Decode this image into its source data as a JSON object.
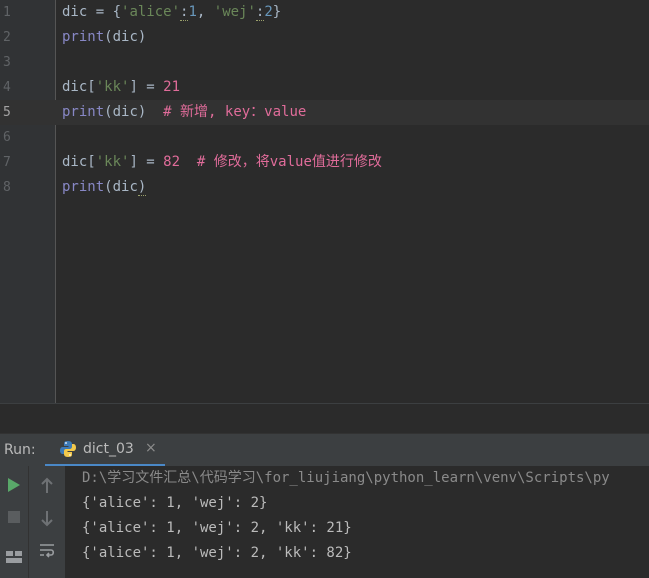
{
  "editor": {
    "lines": [
      {
        "num": "1"
      },
      {
        "num": "2"
      },
      {
        "num": "3"
      },
      {
        "num": "4"
      },
      {
        "num": "5"
      },
      {
        "num": "6"
      },
      {
        "num": "7"
      },
      {
        "num": "8"
      }
    ],
    "code": {
      "l1_a": "dic = {",
      "l1_s1": "'alice'",
      "l1_b": ":",
      "l1_n1": "1",
      "l1_c": ", ",
      "l1_s2": "'wej'",
      "l1_d": ":",
      "l1_n2": "2",
      "l1_e": "}",
      "l2_fn": "print",
      "l2_rest": "(dic)",
      "l4_a": "dic[",
      "l4_s": "'kk'",
      "l4_b": "] = ",
      "l4_n": "21",
      "l5_fn": "print",
      "l5_rest": "(dic)",
      "l5_cmt": "  # 新增, key：value",
      "l7_a": "dic[",
      "l7_s": "'kk'",
      "l7_b": "] = ",
      "l7_n": "82",
      "l7_cmt": "  # 修改，将value值进行修改",
      "l8_fn": "print",
      "l8_rest": "(dic",
      "l8_end": ")"
    },
    "current_line": 5
  },
  "run_panel": {
    "title": "Run:",
    "tab_label": "dict_03",
    "tab_close": "×",
    "console": [
      "D:\\学习文件汇总\\代码学习\\for_liujiang\\python_learn\\venv\\Scripts\\py",
      "{'alice': 1, 'wej': 2}",
      "{'alice': 1, 'wej': 2, 'kk': 21}",
      "{'alice': 1, 'wej': 2, 'kk': 82}"
    ]
  },
  "icons": {
    "run": "play-icon",
    "stop": "stop-icon",
    "up": "arrow-up-icon",
    "down": "arrow-down-icon",
    "wrap": "soft-wrap-icon",
    "layout": "layout-icon"
  },
  "colors": {
    "background": "#2b2b2b",
    "string": "#6a8759",
    "number": "#6897bb",
    "builtin": "#8888c6",
    "comment": "#808080",
    "accent": "#4a88c7",
    "run_green": "#59a869"
  }
}
